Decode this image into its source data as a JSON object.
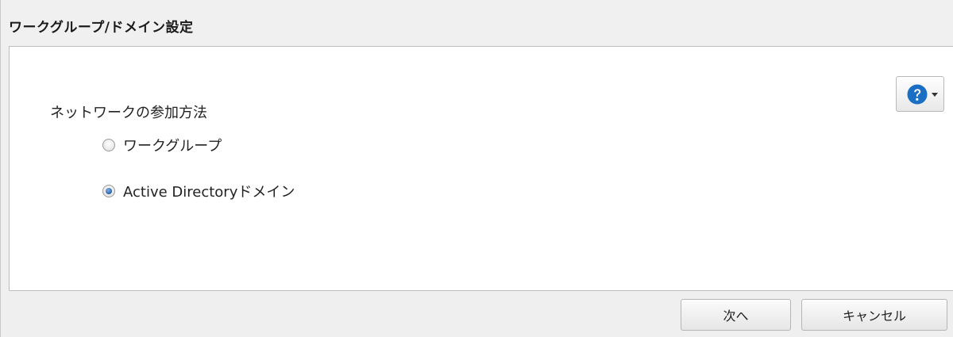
{
  "dialog": {
    "title": "ワークグループ/ドメイン設定"
  },
  "help": {
    "icon": "question-circle-icon",
    "caret_icon": "chevron-down-icon",
    "accent_color": "#1a6fc4"
  },
  "form": {
    "section_label": "ネットワークの参加方法",
    "options": [
      {
        "label": "ワークグループ",
        "checked": false
      },
      {
        "label": "Active Directoryドメイン",
        "checked": true
      }
    ]
  },
  "footer": {
    "next_label": "次へ",
    "cancel_label": "キャンセル"
  }
}
